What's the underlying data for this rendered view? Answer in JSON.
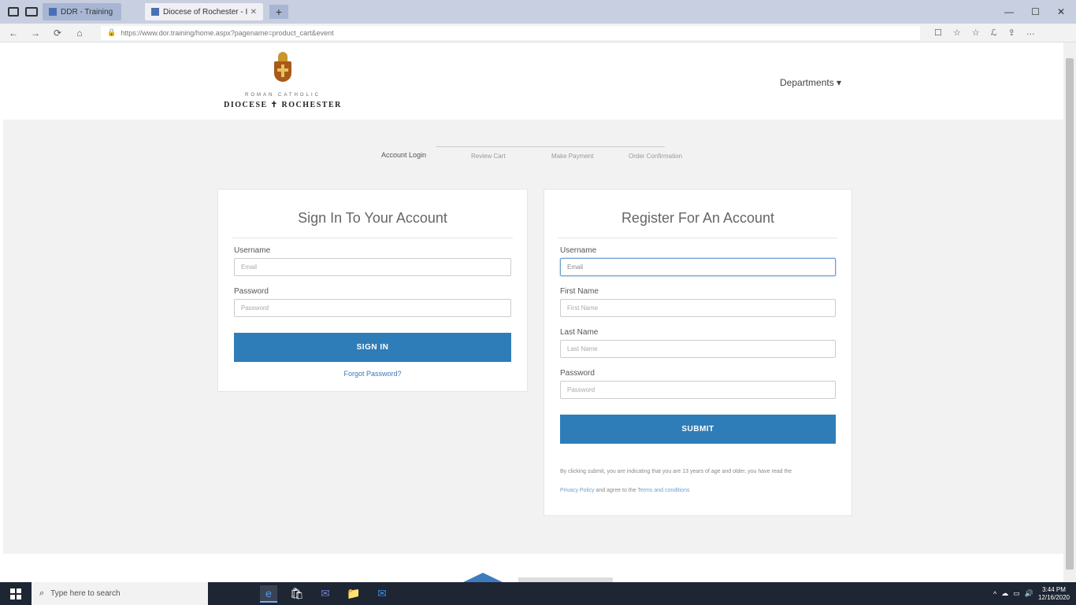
{
  "browser": {
    "tabs": [
      {
        "label": "DDR - Training"
      },
      {
        "label": "Diocese of Rochester - I"
      }
    ],
    "new_tab": "+",
    "window_controls": [
      "—",
      "☐",
      "✕"
    ],
    "url": "https://www.dor.training/home.aspx?pagename=product_cart&event",
    "nav": {
      "back": "←",
      "forward": "→",
      "refresh": "⟳",
      "home": "⌂"
    },
    "addr_icons": [
      "☐",
      "☆",
      "☆",
      "ℒ",
      "⇪",
      "…"
    ]
  },
  "header": {
    "logo_small": "ROMAN CATHOLIC",
    "logo_big": "DIOCESE ✝ ROCHESTER",
    "departments": "Departments ▾"
  },
  "steps": [
    {
      "label": "Account Login"
    },
    {
      "label": "Review Cart"
    },
    {
      "label": "Make Payment"
    },
    {
      "label": "Order Confirmation"
    }
  ],
  "signin": {
    "title": "Sign In To Your Account",
    "username_label": "Username",
    "username_placeholder": "Email",
    "password_label": "Password",
    "password_placeholder": "Password",
    "button": "SIGN IN",
    "forgot": "Forgot Password?"
  },
  "register": {
    "title": "Register For An Account",
    "username_label": "Username",
    "username_placeholder": "Email",
    "first_label": "First Name",
    "first_placeholder": "First Name",
    "last_label": "Last Name",
    "last_placeholder": "Last Name",
    "password_label": "Password",
    "password_placeholder": "Password",
    "button": "SUBMIT",
    "fine_print": "By clicking submit, you are indicating that you are 13 years of age and older, you have read the",
    "privacy_link": "Privacy Policy",
    "agree_text": " and agree to the ",
    "terms_link": "Terms and conditions"
  },
  "taskbar": {
    "search_placeholder": "Type here to search",
    "time": "3:44 PM",
    "date": "12/16/2020",
    "apps": [
      "e",
      "🛍",
      "✉",
      "📁",
      "✉"
    ]
  },
  "colors": {
    "accent": "#2f7db8",
    "page_bg": "#f2f2f2",
    "taskbar": "#1e2533"
  }
}
